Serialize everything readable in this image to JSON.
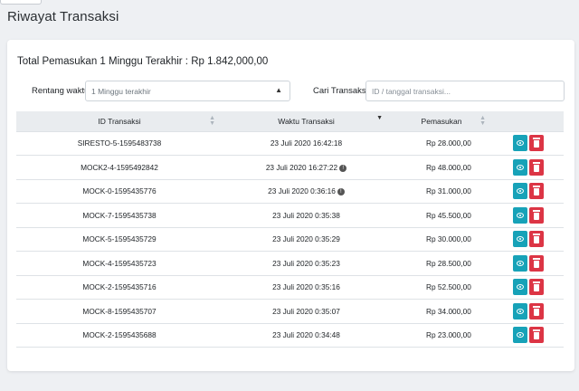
{
  "page": {
    "title": "Riwayat Transaksi"
  },
  "summary": {
    "total_label": "Total Pemasukan 1 Minggu Terakhir : Rp 1.842,000,00"
  },
  "filters": {
    "range_label": "Rentang waktu",
    "range_value": "1 Minggu terakhir",
    "search_label": "Cari Transaksi",
    "search_placeholder": "ID / tanggal transaksi..."
  },
  "table": {
    "columns": [
      "ID Transaksi",
      "Waktu Transaksi",
      "Pemasukan"
    ],
    "rows": [
      {
        "id": "SIRESTO-5-1595483738",
        "time": "23 Juli 2020 16:42:18",
        "amount": "Rp 28.000,00",
        "info": false
      },
      {
        "id": "MOCK2-4-1595492842",
        "time": "23 Juli 2020 16:27:22",
        "amount": "Rp 48.000,00",
        "info": true
      },
      {
        "id": "MOCK-0-1595435776",
        "time": "23 Juli 2020 0:36:16",
        "amount": "Rp 31.000,00",
        "info": true
      },
      {
        "id": "MOCK-7-1595435738",
        "time": "23 Juli 2020 0:35:38",
        "amount": "Rp 45.500,00",
        "info": false
      },
      {
        "id": "MOCK-5-1595435729",
        "time": "23 Juli 2020 0:35:29",
        "amount": "Rp 30.000,00",
        "info": false
      },
      {
        "id": "MOCK-4-1595435723",
        "time": "23 Juli 2020 0:35:23",
        "amount": "Rp 28.500,00",
        "info": false
      },
      {
        "id": "MOCK-2-1595435716",
        "time": "23 Juli 2020 0:35:16",
        "amount": "Rp 52.500,00",
        "info": false
      },
      {
        "id": "MOCK-8-1595435707",
        "time": "23 Juli 2020 0:35:07",
        "amount": "Rp 34.000,00",
        "info": false
      },
      {
        "id": "MOCK-2-1595435688",
        "time": "23 Juli 2020 0:34:48",
        "amount": "Rp 23.000,00",
        "info": false
      }
    ]
  },
  "colors": {
    "view_button": "#17a2b8",
    "delete_button": "#dc3545",
    "header_bg": "#e9ecef"
  },
  "icons": {
    "view": "eye-icon",
    "delete": "trash-icon",
    "info": "info-icon",
    "sort": "sort-icon"
  }
}
